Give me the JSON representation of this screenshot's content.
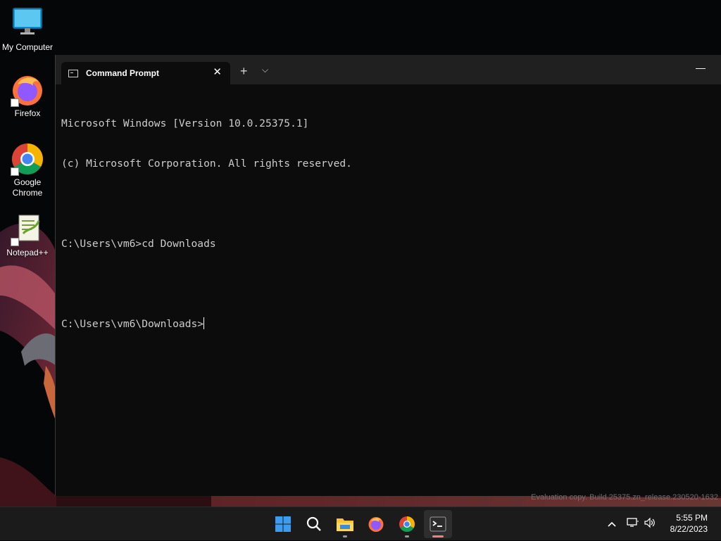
{
  "desktop": {
    "icons": [
      {
        "label": "My Computer"
      },
      {
        "label": "Firefox"
      },
      {
        "label": "Google Chrome"
      },
      {
        "label": "Notepad++"
      }
    ]
  },
  "terminal": {
    "tab_title": "Command Prompt",
    "close_glyph": "✕",
    "new_tab_glyph": "+",
    "dropdown_glyph": "⌵",
    "minimize_glyph": "—",
    "lines": [
      "Microsoft Windows [Version 10.0.25375.1]",
      "(c) Microsoft Corporation. All rights reserved.",
      "",
      "C:\\Users\\vm6>cd Downloads",
      "",
      "C:\\Users\\vm6\\Downloads>"
    ]
  },
  "watermark": "Evaluation copy. Build 25375.zn_release.230520-1632",
  "taskbar": {
    "apps": [
      "start-icon",
      "search-icon",
      "file-explorer-icon",
      "firefox-icon",
      "chrome-icon",
      "terminal-icon"
    ],
    "clock": {
      "time": "5:55 PM",
      "date": "8/22/2023"
    },
    "tray_chevron": "^"
  },
  "colors": {
    "console_bg": "#0c0c0c",
    "console_text": "#cccccc",
    "titlebar": "#202020",
    "taskbar": "#1b1b1b"
  }
}
